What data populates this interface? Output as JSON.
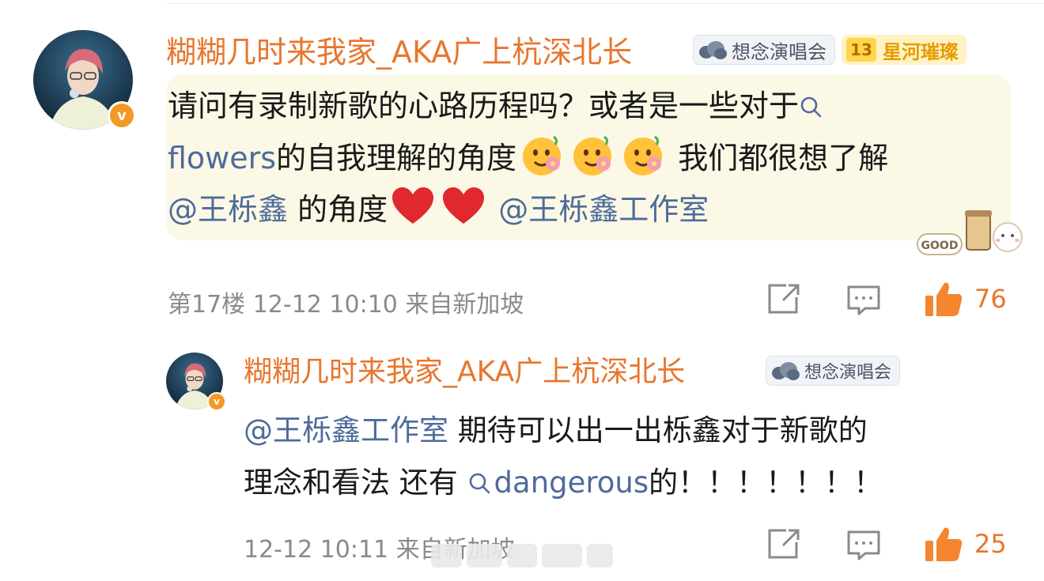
{
  "comments": [
    {
      "username": "糊糊几时来我家_AKA广上杭深北长",
      "badges": {
        "cloud_label": "想念演唱会",
        "star_level": "13",
        "star_label": "星河璀璨"
      },
      "content": {
        "line1": "请问有录制新歌的心路历程吗？或者是一些对于",
        "topic1": "flowers",
        "line2_text": "的自我理解的角度",
        "line2_tail": "我们都很想了解",
        "mention1": "@王栎鑫",
        "line3_mid": "的角度",
        "mention2": "@王栎鑫工作室"
      },
      "sticker_text": "GOOD",
      "meta": "第17楼 12-12 10:10 来自新加坡",
      "likes": "76"
    },
    {
      "username": "糊糊几时来我家_AKA广上杭深北长",
      "badges": {
        "cloud_label": "想念演唱会"
      },
      "content": {
        "mention": "@王栎鑫工作室",
        "line1_tail": "期待可以出一出栎鑫对于新歌的",
        "line2_head": "理念和看法 还有",
        "topic": "dangerous",
        "line2_tail": "的！！！！！！！"
      },
      "meta": "12-12 10:11 来自新加坡",
      "likes": "25"
    }
  ],
  "icons": {
    "verified": "v-badge-icon",
    "search": "search-icon",
    "share": "share-icon",
    "comment": "comment-icon",
    "like": "thumbs-up-icon"
  },
  "colors": {
    "username": "#e8762d",
    "link": "#4e6b9a",
    "meta": "#8a8a8a",
    "bubble": "#fbf8e6"
  }
}
